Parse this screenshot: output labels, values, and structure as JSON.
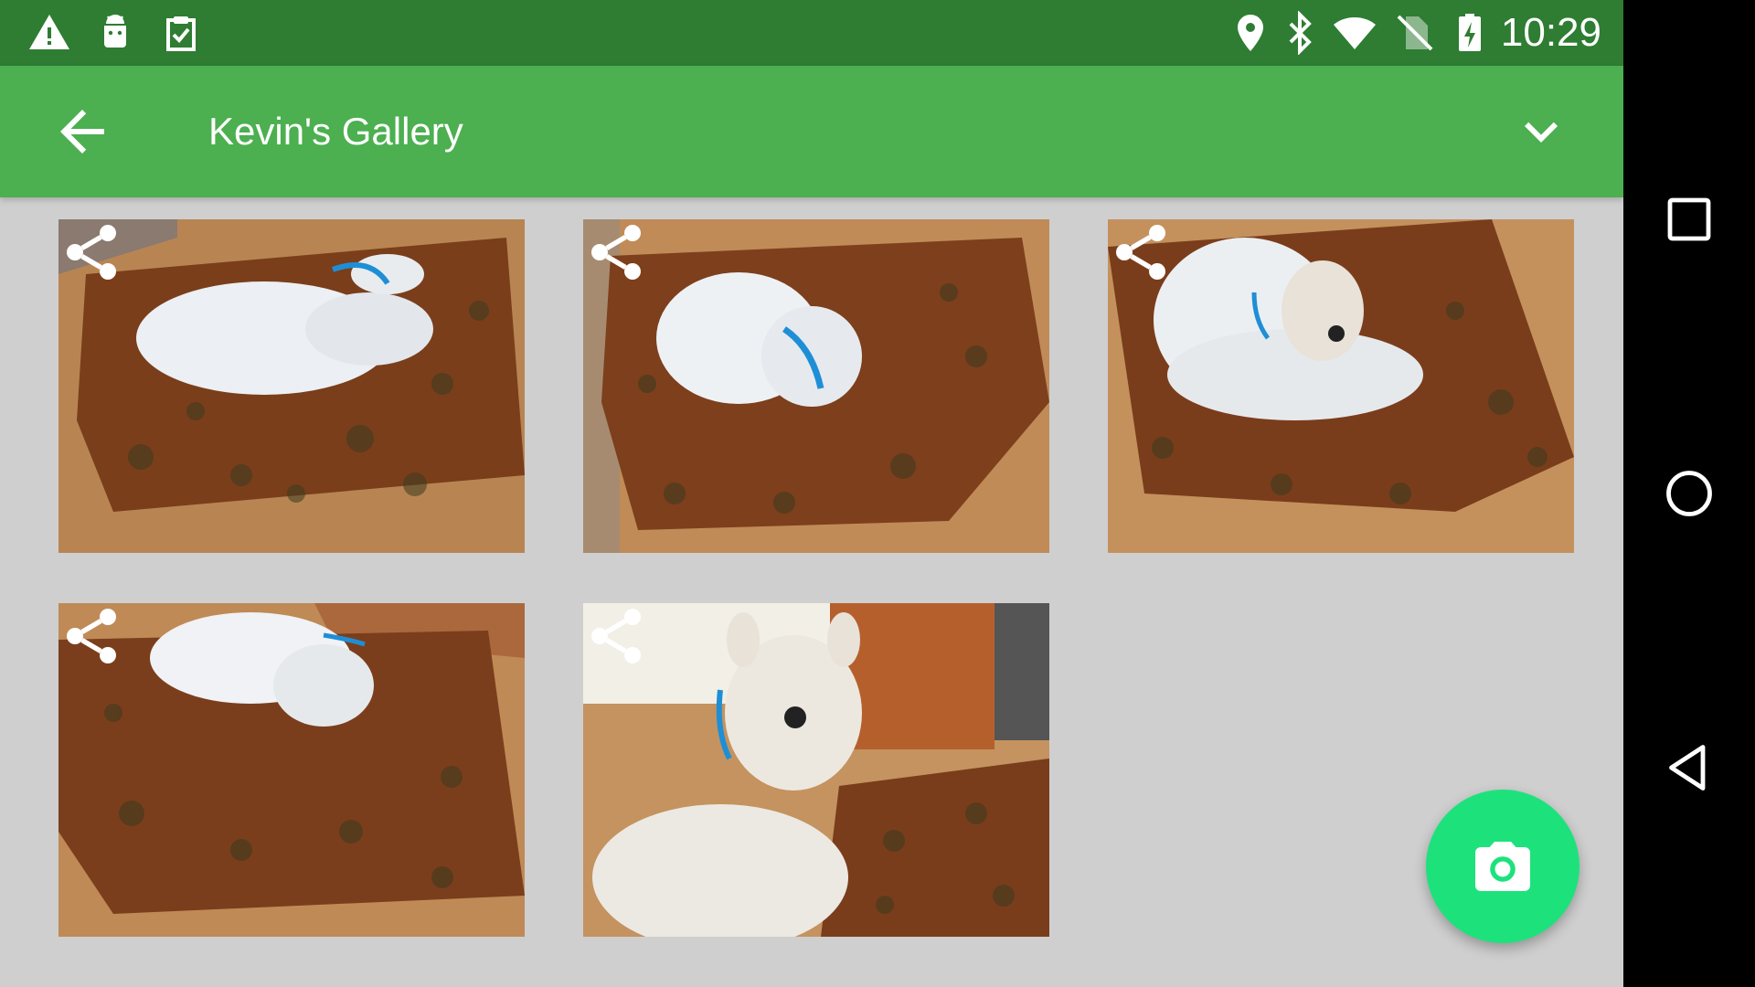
{
  "status_bar": {
    "time": "10:29",
    "left_icons": [
      "warning-icon",
      "android-debug-icon",
      "clipboard-check-icon"
    ],
    "right_icons": [
      "location-icon",
      "bluetooth-icon",
      "wifi-icon",
      "no-sim-icon",
      "battery-charging-icon"
    ],
    "background_color": "#2e7d32"
  },
  "toolbar": {
    "title": "Kevin's Gallery",
    "back_icon": "arrow-back-icon",
    "menu_icon": "chevron-down-icon",
    "background_color": "#4caf50"
  },
  "gallery": {
    "photos": [
      {
        "subject": "white dog lying on blanket",
        "share_icon": "share-icon"
      },
      {
        "subject": "white dog curled on blanket",
        "share_icon": "share-icon"
      },
      {
        "subject": "white dog resting head on blanket",
        "share_icon": "share-icon"
      },
      {
        "subject": "white dog curled on blanket",
        "share_icon": "share-icon"
      },
      {
        "subject": "white dog sitting",
        "share_icon": "share-icon"
      }
    ]
  },
  "fab": {
    "icon": "camera-icon",
    "color": "#1de27c"
  },
  "nav_bar": {
    "buttons": [
      "recents-square-icon",
      "home-circle-icon",
      "back-triangle-icon"
    ]
  }
}
